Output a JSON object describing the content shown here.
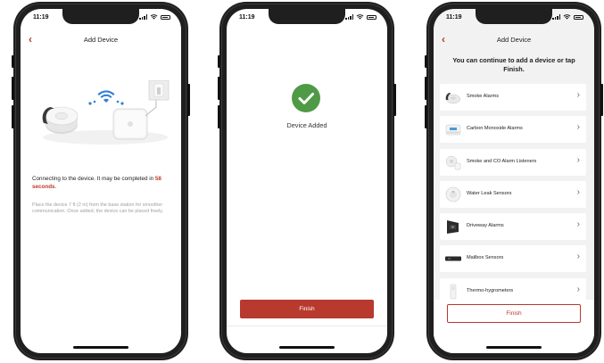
{
  "status": {
    "time": "11:19"
  },
  "screen1": {
    "title": "Add Device",
    "connecting_prefix": "Connecting to the device. It may be completed in ",
    "connecting_time": "58 seconds",
    "connecting_suffix": ".",
    "placement_hint": "Place the device 7 ft (2 m) from the base station for smoother communication. Once added, the device can be placed freely."
  },
  "screen2": {
    "message": "Device Added",
    "finish_label": "Finish"
  },
  "screen3": {
    "title": "Add Device",
    "hint": "You can continue to add a device or tap Finish.",
    "items": [
      {
        "label": "Smoke Alarms",
        "icon": "smoke-alarm-icon"
      },
      {
        "label": "Carbon Monoxide Alarms",
        "icon": "co-alarm-icon"
      },
      {
        "label": "Smoke and CO Alarm Listeners",
        "icon": "listener-icon"
      },
      {
        "label": "Water Leak Sensors",
        "icon": "water-leak-icon"
      },
      {
        "label": "Driveway Alarms",
        "icon": "driveway-alarm-icon"
      },
      {
        "label": "Mailbox Sensors",
        "icon": "mailbox-sensor-icon"
      },
      {
        "label": "Thermo-hygrometers",
        "icon": "thermo-hygrometer-icon"
      }
    ],
    "finish_label": "Finish"
  },
  "colors": {
    "accent": "#b8392e",
    "success": "#4f9a45",
    "wifi": "#2f7fd6"
  }
}
